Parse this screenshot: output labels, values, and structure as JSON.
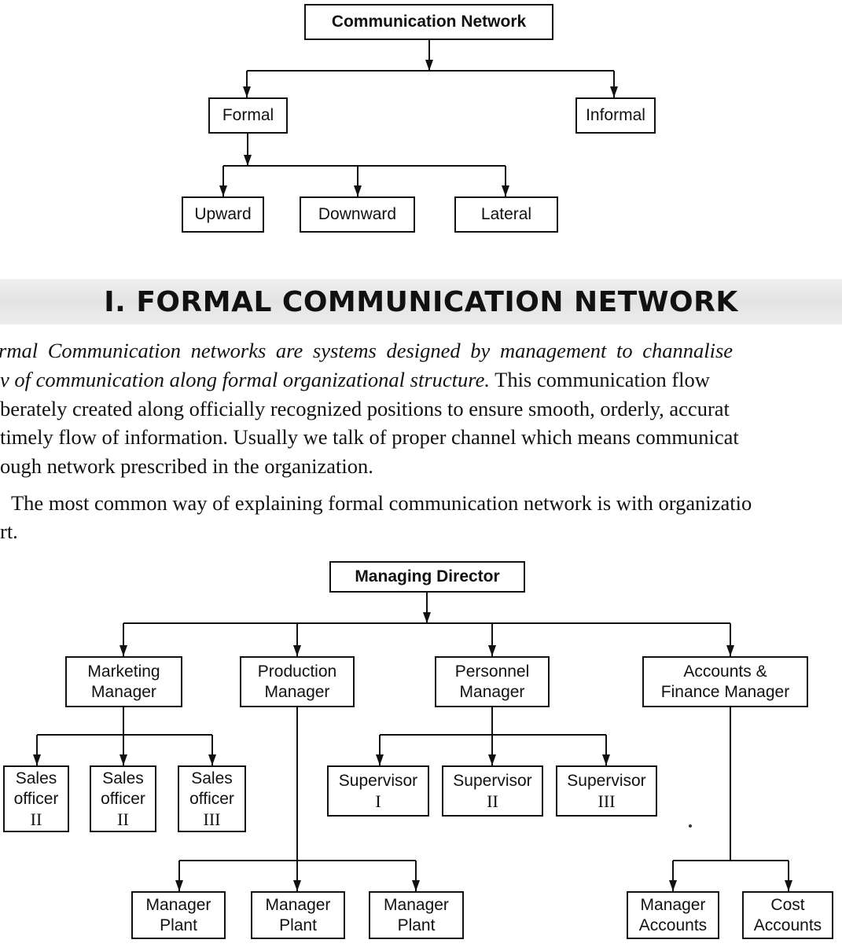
{
  "top_diagram": {
    "root": "Communication Network",
    "level1": [
      "Formal",
      "Informal"
    ],
    "formal_children": [
      "Upward",
      "Downward",
      "Lateral"
    ]
  },
  "section_heading": "I. FORMAL COMMUNICATION NETWORK",
  "paragraph1": {
    "line1_italic": "rmal Communication networks are systems designed by management to channalise",
    "line2_italic": "v of communication along formal organizational structure.",
    "line2_rest": " This communication flow",
    "line3": "berately created along officially recognized positions to ensure smooth, orderly, accurat",
    "line4": " timely flow of information. Usually we talk of proper channel which means communicat",
    "line5": "ough network prescribed in the organization."
  },
  "paragraph2": {
    "line1": "The most common way of explaining formal communication network is with organizatio",
    "line2": "rt."
  },
  "org_chart": {
    "root": "Managing Director",
    "managers": [
      {
        "line1": "Marketing",
        "line2": "Manager"
      },
      {
        "line1": "Production",
        "line2": "Manager"
      },
      {
        "line1": "Personnel",
        "line2": "Manager"
      },
      {
        "line1": "Accounts &",
        "line2": "Finance Manager"
      }
    ],
    "sales_officers": [
      {
        "line1": "Sales",
        "line2": "officer",
        "line3": "II"
      },
      {
        "line1": "Sales",
        "line2": "officer",
        "line3": "II"
      },
      {
        "line1": "Sales",
        "line2": "officer",
        "line3": "III"
      }
    ],
    "plant_managers": [
      {
        "line1": "Manager",
        "line2": "Plant"
      },
      {
        "line1": "Manager",
        "line2": "Plant"
      },
      {
        "line1": "Manager",
        "line2": "Plant"
      }
    ],
    "supervisors": [
      {
        "line1": "Supervisor",
        "line2": "I"
      },
      {
        "line1": "Supervisor",
        "line2": "II"
      },
      {
        "line1": "Supervisor",
        "line2": "III"
      }
    ],
    "accounts_staff": [
      {
        "line1": "Manager",
        "line2": "Accounts"
      },
      {
        "line1": "Cost",
        "line2": "Accounts"
      }
    ]
  }
}
